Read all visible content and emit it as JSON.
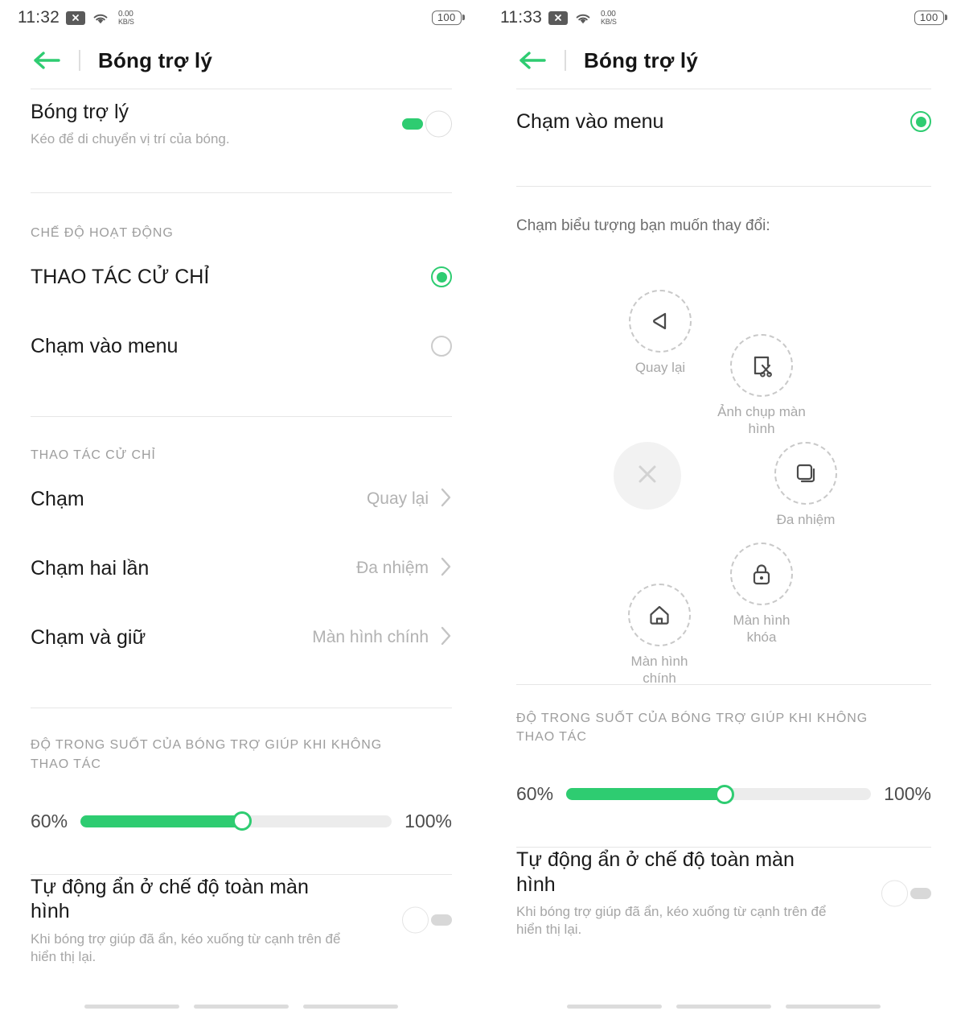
{
  "theme": {
    "accent": "#2ecc71",
    "text_primary": "#1a1a1a",
    "text_muted": "#a6a6a6",
    "divider": "#e6e6e6"
  },
  "left": {
    "status": {
      "time": "11:32",
      "sim_icon": "no-sim-icon",
      "wifi_icon": "wifi-icon",
      "rate_value": "0.00",
      "rate_unit": "KB/S",
      "battery": "100"
    },
    "header": {
      "back_icon": "back-arrow-icon",
      "title": "Bóng trợ lý"
    },
    "main_toggle": {
      "title": "Bóng trợ lý",
      "subtitle": "Kéo để di chuyển vị trí của bóng.",
      "state": "on"
    },
    "mode_section_label": "CHẾ ĐỘ HOẠT ĐỘNG",
    "modes": [
      {
        "label": "THAO TÁC CỬ CHỈ",
        "selected": true
      },
      {
        "label": "Chạm vào menu",
        "selected": false
      }
    ],
    "gesture_section_label": "THAO TÁC CỬ CHỈ",
    "gestures": [
      {
        "label": "Chạm",
        "value": "Quay lại"
      },
      {
        "label": "Chạm hai lần",
        "value": "Đa nhiệm"
      },
      {
        "label": "Chạm và giữ",
        "value": "Màn hình chính"
      }
    ],
    "opacity_section_label": "ĐỘ TRONG SUỐT CỦA BÓNG TRỢ GIÚP KHI KHÔNG THAO TÁC",
    "slider": {
      "min_label": "60%",
      "max_label": "100%",
      "percent": 52
    },
    "autohide": {
      "title": "Tự động ẩn ở chế độ toàn màn hình",
      "subtitle": "Khi bóng trợ giúp đã ẩn, kéo xuống từ cạnh trên để hiển thị lại.",
      "state": "off"
    }
  },
  "right": {
    "status": {
      "time": "11:33",
      "sim_icon": "no-sim-icon",
      "wifi_icon": "wifi-icon",
      "rate_value": "0.00",
      "rate_unit": "KB/S",
      "battery": "100"
    },
    "header": {
      "back_icon": "back-arrow-icon",
      "title": "Bóng trợ lý"
    },
    "menu_mode": {
      "label": "Chạm vào menu",
      "selected": true
    },
    "cluster_hint": "Chạm biểu tượng bạn muốn thay đổi:",
    "cluster_items": [
      {
        "icon": "back-triangle-icon",
        "label": "Quay lại"
      },
      {
        "icon": "screenshot-scissors-icon",
        "label": "Ảnh chụp màn hình"
      },
      {
        "icon": "multitask-squares-icon",
        "label": "Đa nhiệm"
      },
      {
        "icon": "lock-screen-icon",
        "label": "Màn hình khóa"
      },
      {
        "icon": "home-icon",
        "label": "Màn hình chính"
      }
    ],
    "close_ball": {
      "icon": "close-x-icon"
    },
    "opacity_section_label": "ĐỘ TRONG SUỐT CỦA BÓNG TRỢ GIÚP KHI KHÔNG THAO TÁC",
    "slider": {
      "min_label": "60%",
      "max_label": "100%",
      "percent": 52
    },
    "autohide": {
      "title": "Tự động ẩn ở chế độ toàn màn hình",
      "subtitle": "Khi bóng trợ giúp đã ẩn, kéo xuống từ cạnh trên để hiển thị lại.",
      "state": "off"
    }
  }
}
